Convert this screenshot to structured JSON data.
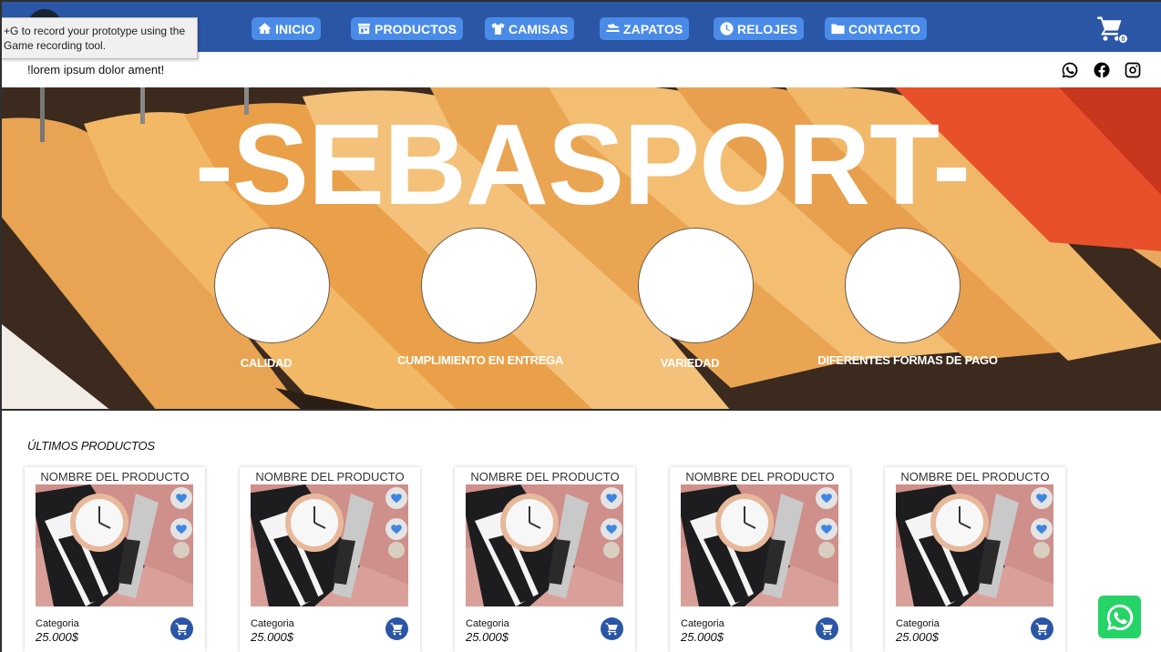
{
  "nav": {
    "items": [
      {
        "label": "INICIO",
        "icon": "home-icon"
      },
      {
        "label": "PRODUCTOS",
        "icon": "store-icon"
      },
      {
        "label": "CAMISAS",
        "icon": "shirt-icon"
      },
      {
        "label": "ZAPATOS",
        "icon": "shoe-icon"
      },
      {
        "label": "RELOJES",
        "icon": "clock-icon"
      },
      {
        "label": "CONTACTO",
        "icon": "folder-icon"
      }
    ],
    "cart_count": "0",
    "accent": "#2b56a6",
    "button_color": "#4a8be8"
  },
  "tooltip": {
    "line1": "+G to record your prototype using the",
    "line2": "Game recording tool."
  },
  "subbar": {
    "text": "!lorem ipsum dolor ament!",
    "social": [
      "whatsapp-icon",
      "facebook-icon",
      "instagram-icon"
    ]
  },
  "hero": {
    "title": "-SEBASPORT-",
    "features": [
      {
        "label": "CALIDAD"
      },
      {
        "label": "CUMPLIMIENTO EN ENTREGA"
      },
      {
        "label": "VARIEDAD"
      },
      {
        "label": "DIFERENTES FORMAS DE PAGO"
      }
    ]
  },
  "products": {
    "section_title": "ÚLTIMOS PRODUCTOS",
    "items": [
      {
        "name": "NOMBRE DEL PRODUCTO",
        "category": "Categoria",
        "price": "25.000$"
      },
      {
        "name": "NOMBRE DEL PRODUCTO",
        "category": "Categoria",
        "price": "25.000$"
      },
      {
        "name": "NOMBRE DEL PRODUCTO",
        "category": "Categoria",
        "price": "25.000$"
      },
      {
        "name": "NOMBRE DEL PRODUCTO",
        "category": "Categoria",
        "price": "25.000$"
      },
      {
        "name": "NOMBRE DEL PRODUCTO",
        "category": "Categoria",
        "price": "25.000$"
      }
    ]
  },
  "whatsapp_float": {
    "icon": "whatsapp-icon",
    "color": "#25d366"
  }
}
